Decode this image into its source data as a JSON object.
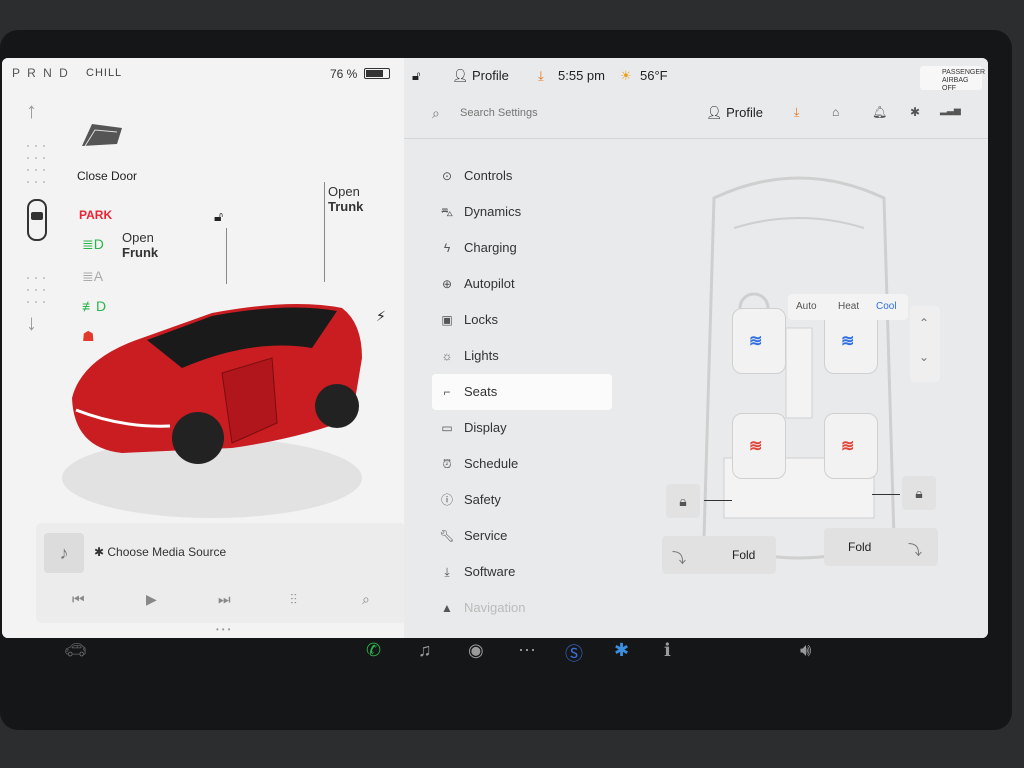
{
  "status_left": {
    "gears": "P R N D",
    "mode": "CHILL",
    "battery_pct": "76 %",
    "battery_level": 0.76
  },
  "status_right": {
    "profile": "Profile",
    "time": "5:55 pm",
    "temp": "56°F",
    "airbag": [
      "PASSENGER",
      "AIRBAG OFF"
    ]
  },
  "left_panel": {
    "close_door": "Close Door",
    "park": "PARK",
    "open_frunk": {
      "line1": "Open",
      "line2": "Frunk"
    },
    "open_trunk": {
      "line1": "Open",
      "line2": "Trunk"
    },
    "media_source": "Choose Media Source"
  },
  "settings": {
    "search_placeholder": "Search Settings",
    "profile": "Profile",
    "menu": [
      {
        "label": "Controls",
        "icon": "toggle-icon"
      },
      {
        "label": "Dynamics",
        "icon": "car-icon"
      },
      {
        "label": "Charging",
        "icon": "bolt-icon"
      },
      {
        "label": "Autopilot",
        "icon": "steering-wheel-icon"
      },
      {
        "label": "Locks",
        "icon": "lock-icon"
      },
      {
        "label": "Lights",
        "icon": "sun-icon"
      },
      {
        "label": "Seats",
        "icon": "seat-icon"
      },
      {
        "label": "Display",
        "icon": "display-icon"
      },
      {
        "label": "Schedule",
        "icon": "alarm-icon"
      },
      {
        "label": "Safety",
        "icon": "info-circle-icon"
      },
      {
        "label": "Service",
        "icon": "wrench-icon"
      },
      {
        "label": "Software",
        "icon": "download-icon"
      },
      {
        "label": "Navigation",
        "icon": "navigation-icon"
      }
    ],
    "active_item": "Seats"
  },
  "seats": {
    "climate_options": [
      "Auto",
      "Heat",
      "Cool"
    ],
    "selected_climate": "Cool",
    "fold_left": "Fold",
    "fold_right": "Fold"
  },
  "colors": {
    "park_red": "#e23b2e",
    "cool_blue": "#2f6fe0",
    "heat_red": "#e0453a",
    "green": "#2cb34a"
  }
}
